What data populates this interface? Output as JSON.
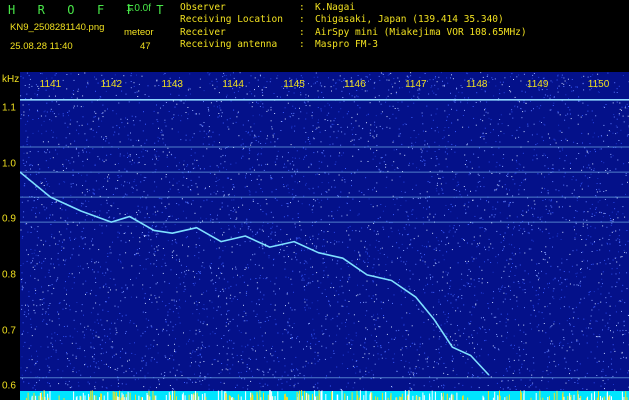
{
  "header": {
    "app_title": "H R O F F T",
    "version": "1.0.0f",
    "file_name": "KN9_2508281140.png",
    "datetime": "25.08.28 11:40",
    "meteor_label": "meteor",
    "meteor_count": "47"
  },
  "station_info": [
    {
      "key": "Observer",
      "value": "K.Nagai"
    },
    {
      "key": "Receiving Location",
      "value": "Chigasaki, Japan (139.414 35.340)"
    },
    {
      "key": "Receiver",
      "value": "AirSpy mini (Miakejima VOR 108.65MHz)"
    },
    {
      "key": "Receiving antenna",
      "value": "Maspro FM-3"
    }
  ],
  "chart_data": {
    "type": "heatmap",
    "ylabel": "kHz",
    "time_ticks": [
      "1141",
      "1142",
      "1143",
      "1144",
      "1145",
      "1146",
      "1147",
      "1148",
      "1149",
      "1150"
    ],
    "freq_ticks": [
      "1.1",
      "1.0",
      "0.9",
      "0.8",
      "0.7",
      "0.6"
    ],
    "freq_range_khz": [
      0.575,
      1.165
    ],
    "time_range_min": [
      1140.5,
      1150.5
    ],
    "carrier_lines_khz": [
      1.115,
      1.03,
      0.985,
      0.94,
      0.895,
      0.615
    ],
    "drifting_trace": {
      "time": [
        1140.5,
        1141.0,
        1141.5,
        1142.0,
        1142.3,
        1142.7,
        1143.0,
        1143.4,
        1143.8,
        1144.2,
        1144.6,
        1145.0,
        1145.4,
        1145.8,
        1146.2,
        1146.6,
        1147.0,
        1147.3,
        1147.6,
        1147.9,
        1148.2
      ],
      "freq_khz": [
        0.985,
        0.94,
        0.915,
        0.895,
        0.905,
        0.88,
        0.875,
        0.885,
        0.86,
        0.87,
        0.85,
        0.86,
        0.84,
        0.83,
        0.8,
        0.79,
        0.76,
        0.72,
        0.67,
        0.655,
        0.62
      ]
    },
    "colors": {
      "background": "#04118a",
      "noise": "#3a5cff",
      "carrier": "#8ed8ff",
      "trace": "#7fe0ff",
      "labels": "#f0e020",
      "title": "#48e848",
      "bottom_band": "#00e5ff"
    }
  }
}
